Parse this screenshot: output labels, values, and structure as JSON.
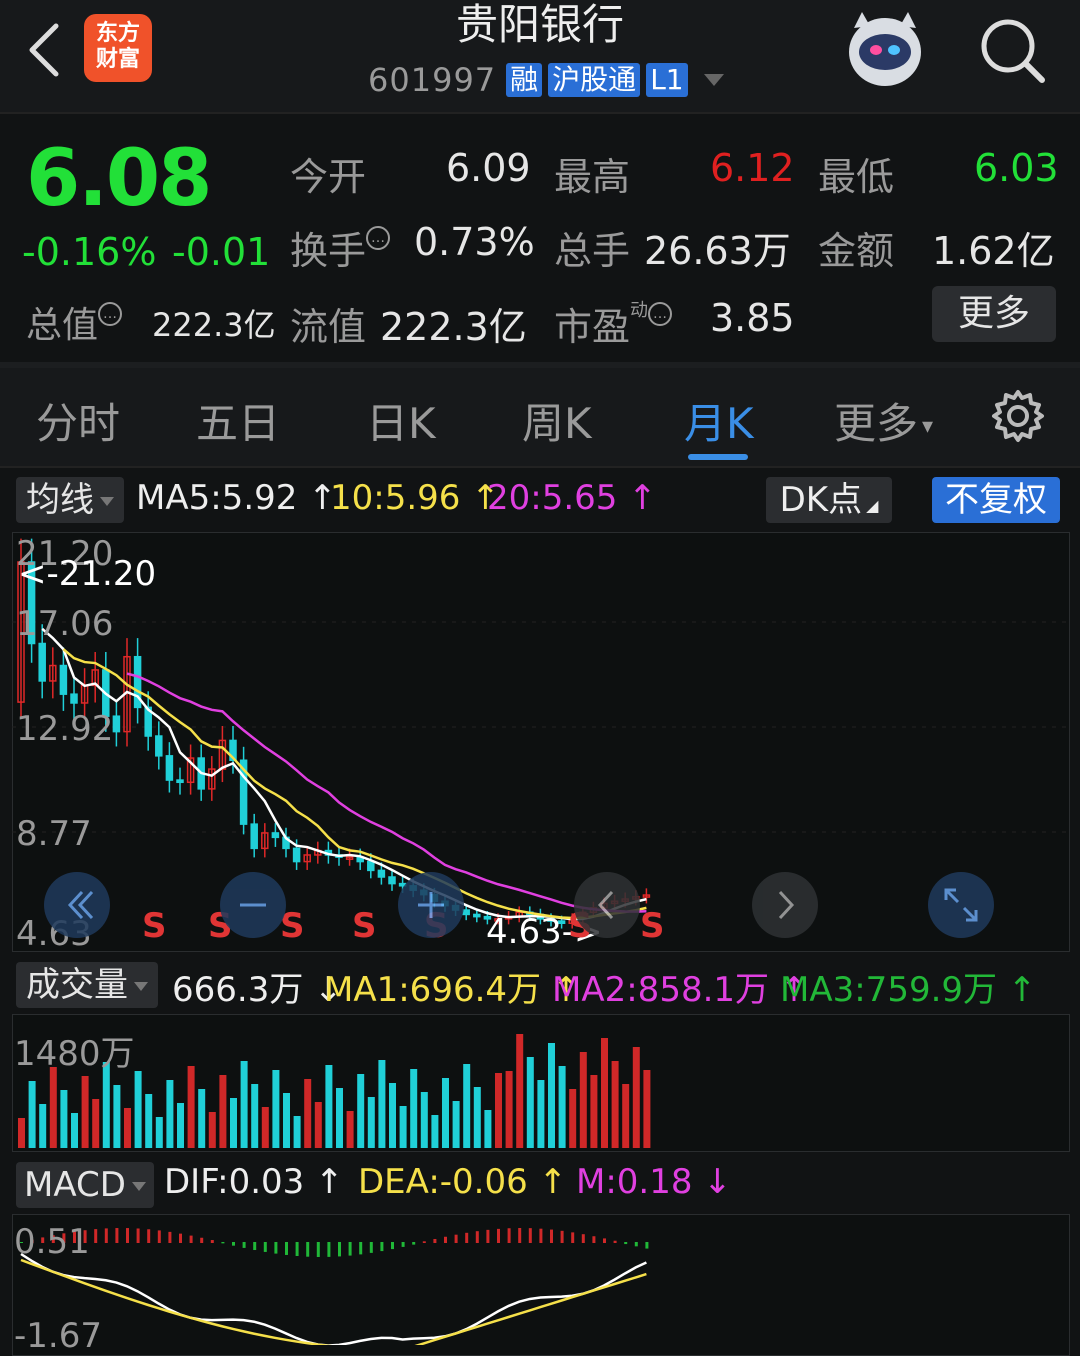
{
  "header": {
    "back_icon": "back-arrow-icon",
    "logo_text": [
      "东方",
      "财富"
    ],
    "title": "贵阳银行",
    "code": "601997",
    "tags": [
      "融",
      "沪股通",
      "L1"
    ],
    "avatar_icon": "robot-avatar-icon",
    "search_icon": "search-icon"
  },
  "quote": {
    "price": "6.08",
    "change_pct": "-0.16%",
    "change": "-0.01",
    "open_label": "今开",
    "open": "6.09",
    "high_label": "最高",
    "high": "6.12",
    "low_label": "最低",
    "low": "6.03",
    "turnover_label": "换手",
    "turnover": "0.73%",
    "volume_label": "总手",
    "volume": "26.63万",
    "amount_label": "金额",
    "amount": "1.62亿",
    "mktcap_label": "总值",
    "mktcap": "222.3亿",
    "float_label": "流值",
    "float_cap": "222.3亿",
    "pe_label": "市盈",
    "pe_sup": "动",
    "pe": "3.85",
    "more_label": "更多",
    "colors": {
      "down": "#22e038",
      "up": "#e02020"
    }
  },
  "tabs": {
    "items": [
      "分时",
      "五日",
      "日K",
      "周K",
      "月K",
      "更多"
    ],
    "active": "月K",
    "settings_icon": "gear-icon"
  },
  "ma_row": {
    "selector": "均线",
    "ma5": "MA5:5.92",
    "ma10": "10:5.96",
    "ma20": "20:5.65",
    "dk_label": "DK点",
    "fq_label": "不复权"
  },
  "price_chart": {
    "axis": [
      "21.20",
      "17.06",
      "12.92",
      "8.77",
      "4.63"
    ],
    "max_marker": "<-21.20",
    "min_marker": "4.63->",
    "signal": "S"
  },
  "controls": [
    "rewind-icon",
    "minus-icon",
    "zoom-in-icon",
    "prev-icon",
    "next-icon",
    "fullscreen-icon"
  ],
  "vol_row": {
    "selector": "成交量",
    "current": "666.3万",
    "ma1": "MA1:696.4万",
    "ma2": "MA2:858.1万",
    "ma3": "MA3:759.9万",
    "axis_top": "1480万"
  },
  "macd_row": {
    "selector": "MACD",
    "dif": "DIF:0.03",
    "dea": "DEA:-0.06",
    "m": "M:0.18",
    "axis_top": "0.51",
    "axis_bottom": "-1.67"
  },
  "chart_data": {
    "type": "candlestick",
    "period": "monthly",
    "ylim": [
      4.63,
      21.2
    ],
    "approx_monthly_closes": [
      21.2,
      17.5,
      15.8,
      16.5,
      15.2,
      14.8,
      15.6,
      16.3,
      14.2,
      13.5,
      16.9,
      14.6,
      13.3,
      12.4,
      11.3,
      11.2,
      12.3,
      10.9,
      11.8,
      13.1,
      12.2,
      9.3,
      8.2,
      8.9,
      8.7,
      8.2,
      7.6,
      7.9,
      8.1,
      7.9,
      7.8,
      7.8,
      7.6,
      7.2,
      6.9,
      6.6,
      6.5,
      6.3,
      6.1,
      5.8,
      5.6,
      5.4,
      5.2,
      5.1,
      5.0,
      5.0,
      5.1,
      5.3,
      5.2,
      5.0,
      4.9,
      4.8,
      5.0,
      5.3,
      5.5,
      5.7,
      5.8,
      5.9,
      6.0,
      6.08
    ]
  }
}
